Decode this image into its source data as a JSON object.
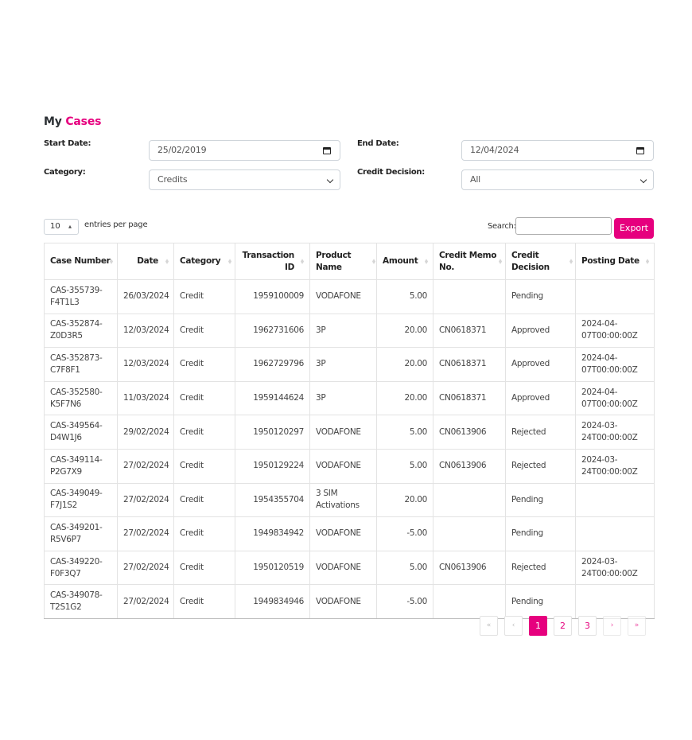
{
  "title": {
    "prefix": "My",
    "accent": "Cases"
  },
  "colors": {
    "accent": "#e6007e"
  },
  "filters": {
    "start_date": {
      "label": "Start Date:",
      "value": "25/02/2019",
      "icon": "calendar-icon"
    },
    "end_date": {
      "label": "End Date:",
      "value": "12/04/2024",
      "icon": "calendar-icon"
    },
    "category": {
      "label": "Category:",
      "value": "Credits",
      "icon": "chevron-down-icon"
    },
    "credit_decision": {
      "label": "Credit Decision:",
      "value": "All",
      "icon": "chevron-down-icon"
    }
  },
  "toolbar": {
    "entries_value": "10",
    "entries_arrows": "⬍",
    "entries_label": "entries per page",
    "search_label": "Search:",
    "search_value": "",
    "export_label": "Export"
  },
  "table": {
    "headers": [
      {
        "label": "Case Number"
      },
      {
        "label": "Date"
      },
      {
        "label": "Category"
      },
      {
        "label": "Transaction ID"
      },
      {
        "label": "Product Name"
      },
      {
        "label": "Amount"
      },
      {
        "label": "Credit Memo No."
      },
      {
        "label": "Credit Decision"
      },
      {
        "label": "Posting Date"
      }
    ],
    "sort_glyph": "⬧",
    "rows": [
      [
        "CAS-355739-F4T1L3",
        "26/03/2024",
        "Credit",
        "1959100009",
        "VODAFONE",
        "5.00",
        "",
        "Pending",
        ""
      ],
      [
        "CAS-352874-Z0D3R5",
        "12/03/2024",
        "Credit",
        "1962731606",
        "3P",
        "20.00",
        "CN0618371",
        "Approved",
        "2024-04-07T00:00:00Z"
      ],
      [
        "CAS-352873-C7F8F1",
        "12/03/2024",
        "Credit",
        "1962729796",
        "3P",
        "20.00",
        "CN0618371",
        "Approved",
        "2024-04-07T00:00:00Z"
      ],
      [
        "CAS-352580-K5F7N6",
        "11/03/2024",
        "Credit",
        "1959144624",
        "3P",
        "20.00",
        "CN0618371",
        "Approved",
        "2024-04-07T00:00:00Z"
      ],
      [
        "CAS-349564-D4W1J6",
        "29/02/2024",
        "Credit",
        "1950120297",
        "VODAFONE",
        "5.00",
        "CN0613906",
        "Rejected",
        "2024-03-24T00:00:00Z"
      ],
      [
        "CAS-349114-P2G7X9",
        "27/02/2024",
        "Credit",
        "1950129224",
        "VODAFONE",
        "5.00",
        "CN0613906",
        "Rejected",
        "2024-03-24T00:00:00Z"
      ],
      [
        "CAS-349049-F7J1S2",
        "27/02/2024",
        "Credit",
        "1954355704",
        "3 SIM Activations",
        "20.00",
        "",
        "Pending",
        ""
      ],
      [
        "CAS-349201-R5V6P7",
        "27/02/2024",
        "Credit",
        "1949834942",
        "VODAFONE",
        "-5.00",
        "",
        "Pending",
        ""
      ],
      [
        "CAS-349220-F0F3Q7",
        "27/02/2024",
        "Credit",
        "1950120519",
        "VODAFONE",
        "5.00",
        "CN0613906",
        "Rejected",
        "2024-03-24T00:00:00Z"
      ],
      [
        "CAS-349078-T2S1G2",
        "27/02/2024",
        "Credit",
        "1949834946",
        "VODAFONE",
        "-5.00",
        "",
        "Pending",
        ""
      ]
    ]
  },
  "pagination": {
    "first": "«",
    "prev": "‹",
    "pages": [
      "1",
      "2",
      "3"
    ],
    "current": "1",
    "next": "›",
    "last": "»"
  }
}
